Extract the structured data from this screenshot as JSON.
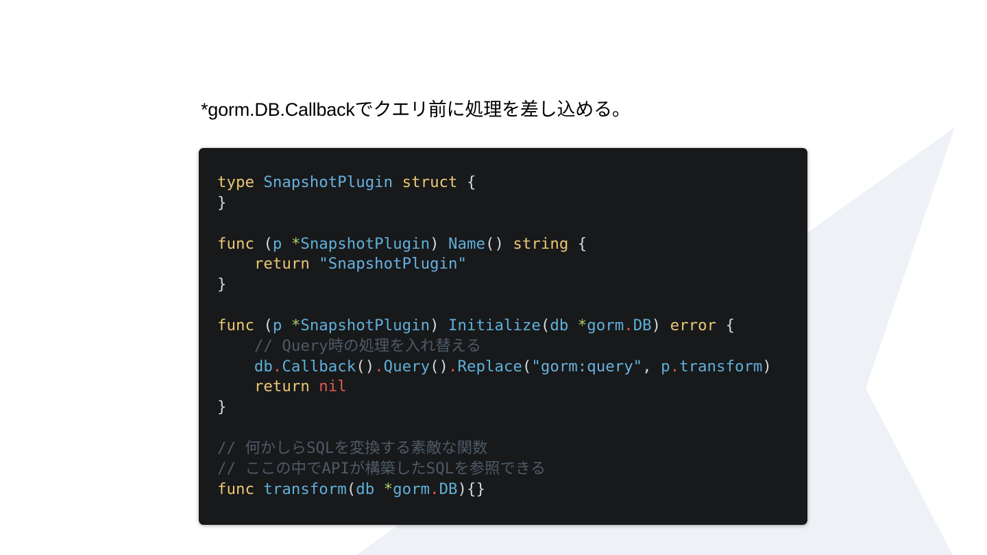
{
  "slide": {
    "heading": "*gorm.DB.Callbackでクエリ前に処理を差し込める。"
  },
  "code": {
    "line1": {
      "kw1": "type",
      "name": "SnapshotPlugin",
      "kw2": "struct",
      "brace": "{"
    },
    "line2": {
      "brace": "}"
    },
    "line4": {
      "kw": "func",
      "open": "(",
      "recv": "p",
      "star": "*",
      "recvType": "SnapshotPlugin",
      "close": ")",
      "fn": "Name",
      "parens": "()",
      "ret": "string",
      "brace": "{"
    },
    "line5": {
      "kw": "return",
      "str": "\"SnapshotPlugin\""
    },
    "line6": {
      "brace": "}"
    },
    "line8": {
      "kw": "func",
      "open": "(",
      "recv": "p",
      "star": "*",
      "recvType": "SnapshotPlugin",
      "close": ")",
      "fn": "Initialize",
      "open2": "(",
      "arg": "db",
      "star2": "*",
      "pkg": "gorm",
      "dot": ".",
      "typ": "DB",
      "close2": ")",
      "ret": "error",
      "brace": "{"
    },
    "line9": {
      "comment": "// Query時の処理を入れ替える"
    },
    "line10": {
      "obj": "db",
      "dot1": ".",
      "m1": "Callback",
      "p1": "()",
      "dot2": ".",
      "m2": "Query",
      "p2": "()",
      "dot3": ".",
      "m3": "Replace",
      "open": "(",
      "str": "\"gorm:query\"",
      "comma": ",",
      "arg": "p",
      "dot4": ".",
      "field": "transform",
      "close": ")"
    },
    "line11": {
      "kw": "return",
      "nil": "nil"
    },
    "line12": {
      "brace": "}"
    },
    "line14": {
      "comment": "// 何かしらSQLを変換する素敵な関数"
    },
    "line15": {
      "comment": "// ここの中でAPIが構築したSQLを参照できる"
    },
    "line16": {
      "kw": "func",
      "fn": "transform",
      "open": "(",
      "arg": "db",
      "star": "*",
      "pkg": "gorm",
      "dot": ".",
      "typ": "DB",
      "close": ")",
      "body": "{}"
    }
  },
  "colors": {
    "card_background": "#18191b",
    "keyword": "#e9c873",
    "identifier": "#5fb0d9",
    "operator": "#a9cf6a",
    "dot": "#e05a4e",
    "comment": "#4d5a66",
    "background_shape": "#eef2f7"
  }
}
